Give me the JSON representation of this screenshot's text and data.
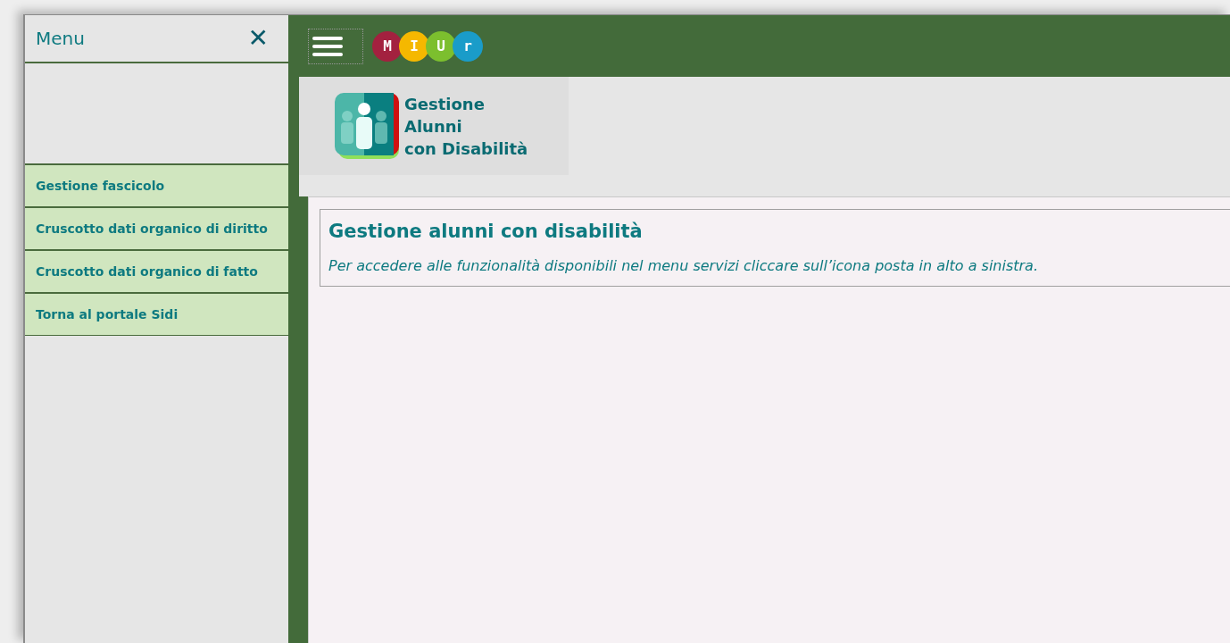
{
  "sidebar": {
    "title": "Menu",
    "close": "✕",
    "items": [
      {
        "label": "Gestione fascicolo",
        "selected": false
      },
      {
        "label": "Cruscotto dati organico di diritto",
        "selected": false
      },
      {
        "label": "Cruscotto dati organico di fatto",
        "selected": false
      },
      {
        "label": "Torna al portale Sidi",
        "selected": false
      }
    ]
  },
  "header": {
    "logo_letters": [
      {
        "letter": "M",
        "color": "#a3213f"
      },
      {
        "letter": "I",
        "color": "#f5b800"
      },
      {
        "letter": "U",
        "color": "#7cbf2e"
      },
      {
        "letter": "r",
        "color": "#1a9cc9"
      }
    ]
  },
  "app_logo": {
    "lines": [
      "Gestione",
      "Alunni",
      "con Disabilità"
    ]
  },
  "content": {
    "title": "Gestione alunni con disabilità",
    "message": "Per accedere alle funzionalità disponibili nel menu servizi cliccare sull’icona posta in alto a sinistra."
  }
}
